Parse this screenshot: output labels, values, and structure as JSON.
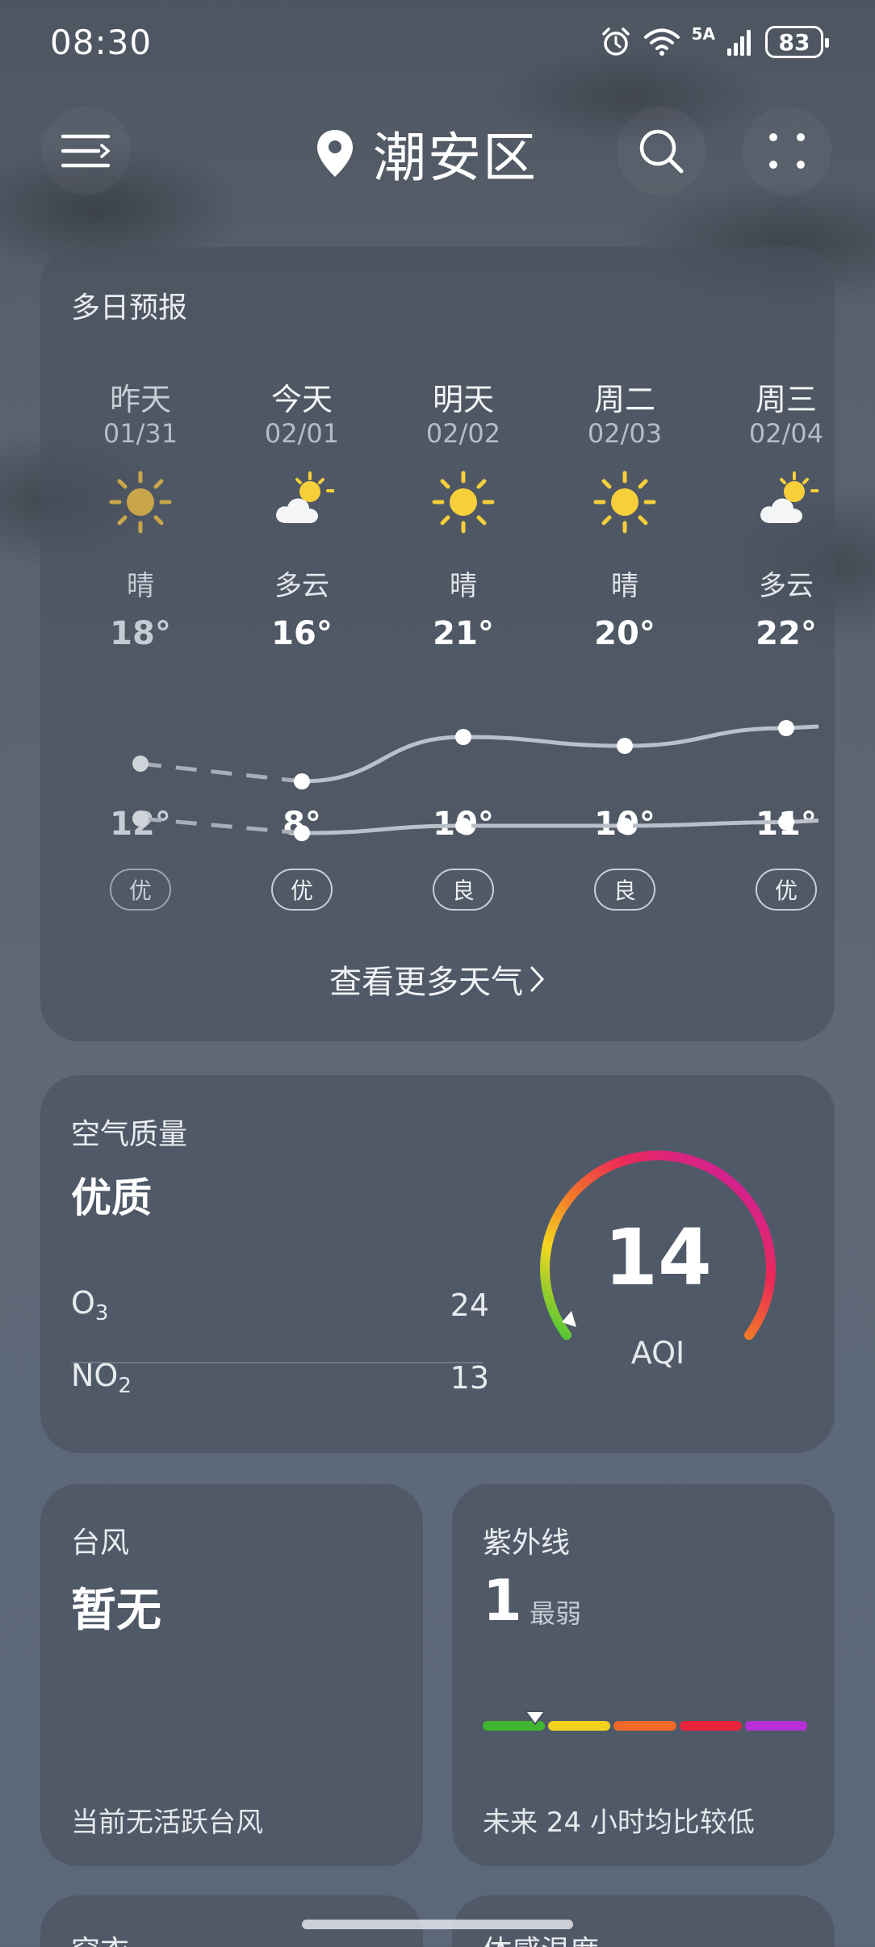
{
  "status_bar": {
    "time": "08:30",
    "network": "5A",
    "battery": "83"
  },
  "header": {
    "location": "潮安区"
  },
  "forecast": {
    "title": "多日预报",
    "more_label": "查看更多天气",
    "days": [
      {
        "name": "昨天",
        "date": "01/31",
        "icon": "sun-icon",
        "condition": "晴",
        "high": "18°",
        "low": "12°",
        "aqi": "优",
        "high_value": 18,
        "low_value": 12
      },
      {
        "name": "今天",
        "date": "02/01",
        "icon": "partly-cloudy-icon",
        "condition": "多云",
        "high": "16°",
        "low": "8°",
        "aqi": "优",
        "high_value": 16,
        "low_value": 8
      },
      {
        "name": "明天",
        "date": "02/02",
        "icon": "sun-icon",
        "condition": "晴",
        "high": "21°",
        "low": "10°",
        "aqi": "良",
        "high_value": 21,
        "low_value": 10
      },
      {
        "name": "周二",
        "date": "02/03",
        "icon": "sun-icon",
        "condition": "晴",
        "high": "20°",
        "low": "10°",
        "aqi": "良",
        "high_value": 20,
        "low_value": 10
      },
      {
        "name": "周三",
        "date": "02/04",
        "icon": "partly-cloudy-icon",
        "condition": "多云",
        "high": "22°",
        "low": "11°",
        "aqi": "优",
        "high_value": 22,
        "low_value": 11
      }
    ]
  },
  "air_quality": {
    "title": "空气质量",
    "status": "优质",
    "aqi_value": "14",
    "aqi_label": "AQI",
    "aqi_level": 14,
    "pollutants": [
      {
        "name": "O",
        "sub": "3",
        "value": "24"
      },
      {
        "name": "NO",
        "sub": "2",
        "value": "13"
      }
    ]
  },
  "typhoon": {
    "title": "台风",
    "value": "暂无",
    "footer": "当前无活跃台风"
  },
  "uv": {
    "title": "紫外线",
    "index": "1",
    "level": "最弱",
    "footer": "未来 24 小时均比较低",
    "index_value": 1,
    "scale_colors": [
      "#3fb52f",
      "#f2d21c",
      "#ef6a2a",
      "#e8233c",
      "#b72fd8"
    ]
  },
  "bottom_cards": {
    "left_title": "穿衣",
    "right_title": "体感温度"
  }
}
